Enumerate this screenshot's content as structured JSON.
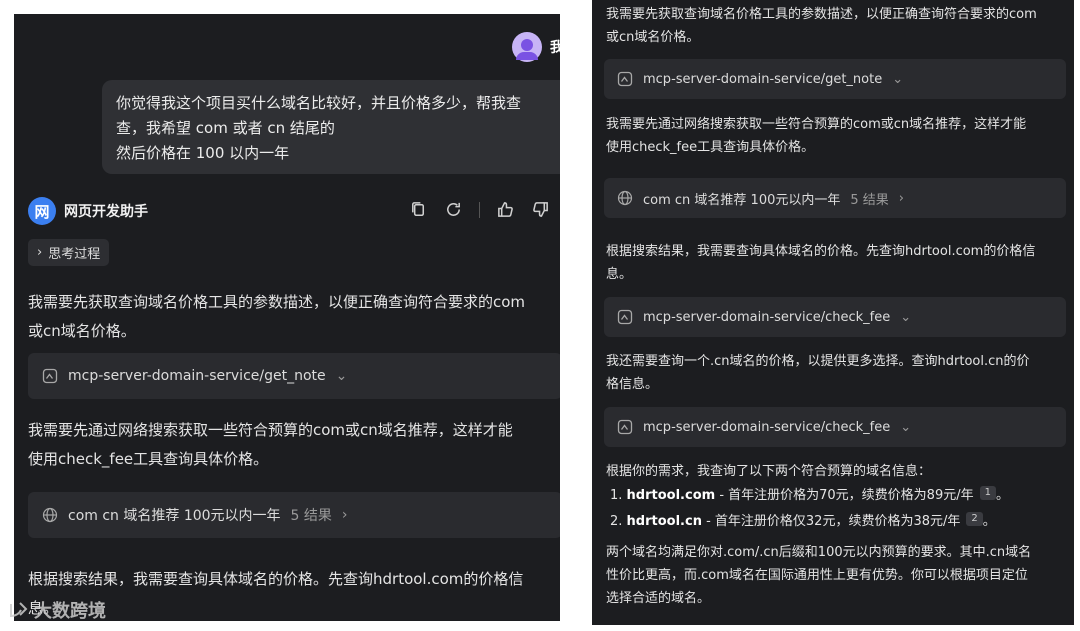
{
  "left": {
    "user_name": "我",
    "user_message_lines": [
      "你觉得我这个项目买什么域名比较好，并且价格多少，帮我查",
      "查，我希望 com 或者 cn 结尾的",
      "然后价格在 100 以内一年"
    ],
    "bot_avatar_char": "网",
    "bot_name": "网页开发助手",
    "thinking_label": "思考过程",
    "para1_lines": [
      "我需要先获取查询域名价格工具的参数描述，以便正确查询符合要求的com",
      "或cn域名价格。"
    ],
    "tool1": "mcp-server-domain-service/get_note",
    "para2_lines": [
      "我需要先通过网络搜索获取一些符合预算的com或cn域名推荐，这样才能",
      "使用check_fee工具查询具体价格。"
    ],
    "search_query": "com cn 域名推荐 100元以内一年",
    "search_results": "5 结果",
    "para3_lines": [
      "根据搜索结果，我需要查询具体域名的价格。先查询hdrtool.com的价格信",
      "息。"
    ]
  },
  "right": {
    "top_lines": [
      "我需要先获取查询域名价格工具的参数描述，以便正确查询符合要求的com",
      "或cn域名价格。"
    ],
    "tool1": "mcp-server-domain-service/get_note",
    "para2_lines": [
      "我需要先通过网络搜索获取一些符合预算的com或cn域名推荐，这样才能",
      "使用check_fee工具查询具体价格。"
    ],
    "search_query": "com cn 域名推荐 100元以内一年",
    "search_results": "5 结果",
    "para3_lines": [
      "根据搜索结果，我需要查询具体域名的价格。先查询hdrtool.com的价格信",
      "息。"
    ],
    "tool2": "mcp-server-domain-service/check_fee",
    "para4_lines": [
      "我还需要查询一个.cn域名的价格，以提供更多选择。查询hdrtool.cn的价",
      "格信息。"
    ],
    "tool3": "mcp-server-domain-service/check_fee",
    "summary_intro": "根据你的需求，我查询了以下两个符合预算的域名信息：",
    "list": [
      {
        "num": "1.",
        "domain": "hdrtool.com",
        "text": " - 首年注册价格为70元，续费价格为89元/年",
        "cite": "1",
        "end": "。"
      },
      {
        "num": "2.",
        "domain": "hdrtool.cn",
        "text": " - 首年注册价格仅32元，续费价格为38元/年",
        "cite": "2",
        "end": "。"
      }
    ],
    "final_lines": [
      "两个域名均满足你对.com/.cn后缀和100元以内预算的要求。其中.cn域名",
      "性价比更高，而.com域名在国际通用性上更有优势。你可以根据项目定位",
      "选择合适的域名。"
    ]
  },
  "watermark": "大数跨境"
}
